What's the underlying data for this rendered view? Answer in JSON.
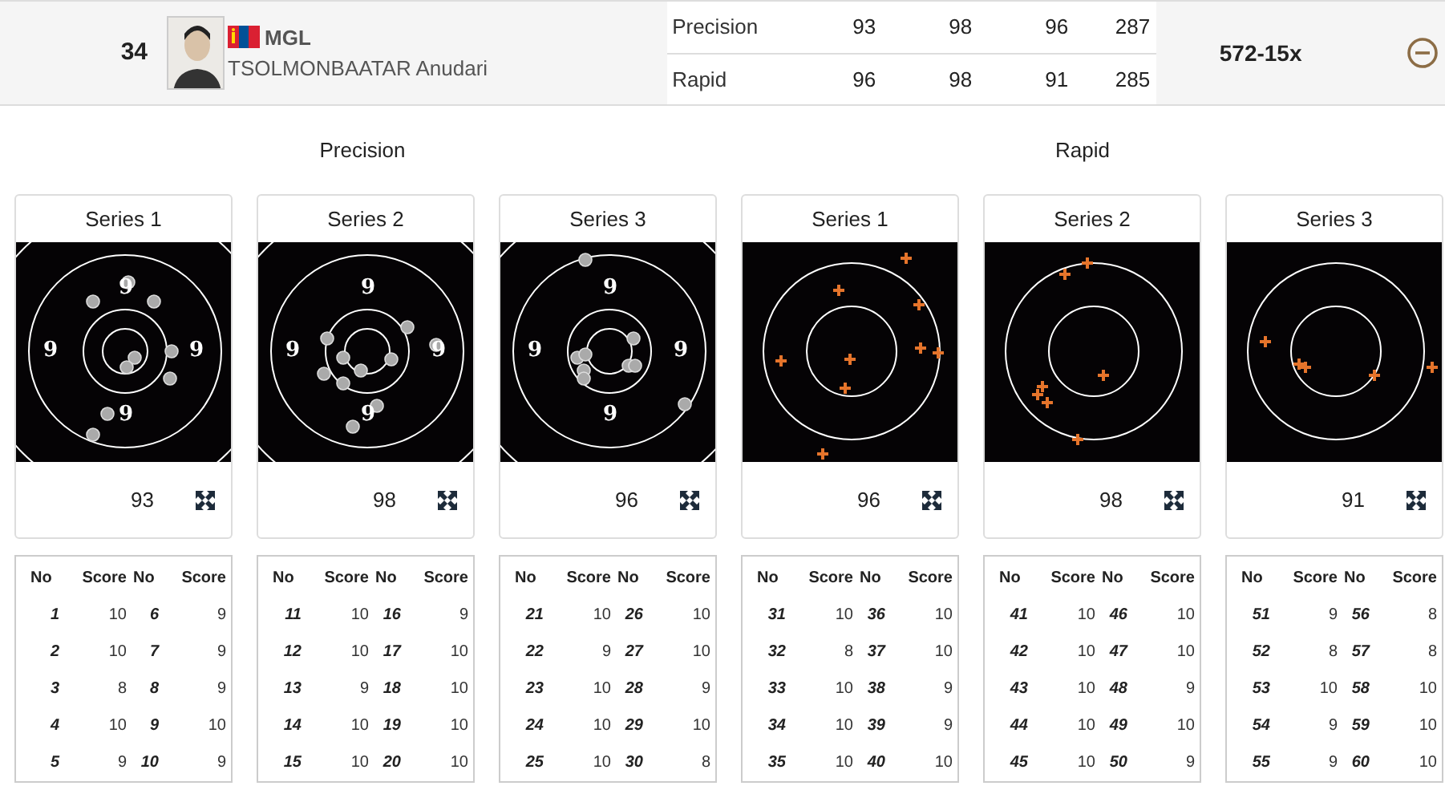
{
  "athlete": {
    "rank": "34",
    "country": "MGL",
    "name": "TSOLMONBAATAR Anudari",
    "total": "572-15x",
    "expanded": true,
    "stages": [
      {
        "label": "Precision",
        "scores": [
          "93",
          "98",
          "96"
        ],
        "total": "287"
      },
      {
        "label": "Rapid",
        "scores": [
          "96",
          "98",
          "91"
        ],
        "total": "285"
      }
    ]
  },
  "sections": [
    {
      "title": "Precision",
      "kind": "precision",
      "series": [
        {
          "title": "Series 1",
          "score": "93",
          "ring_labels": [
            "9",
            "9",
            "9",
            "9"
          ],
          "columns": [
            "No",
            "Score",
            "No",
            "Score"
          ],
          "shots": [
            {
              "no": "1",
              "score": "10"
            },
            {
              "no": "2",
              "score": "10"
            },
            {
              "no": "3",
              "score": "8"
            },
            {
              "no": "4",
              "score": "10"
            },
            {
              "no": "5",
              "score": "9"
            },
            {
              "no": "6",
              "score": "9"
            },
            {
              "no": "7",
              "score": "9"
            },
            {
              "no": "8",
              "score": "9"
            },
            {
              "no": "9",
              "score": "10"
            },
            {
              "no": "10",
              "score": "9"
            }
          ]
        },
        {
          "title": "Series 2",
          "score": "98",
          "ring_labels": [
            "9",
            "9",
            "9",
            "9"
          ],
          "columns": [
            "No",
            "Score",
            "No",
            "Score"
          ],
          "shots": [
            {
              "no": "11",
              "score": "10"
            },
            {
              "no": "12",
              "score": "10"
            },
            {
              "no": "13",
              "score": "9"
            },
            {
              "no": "14",
              "score": "10"
            },
            {
              "no": "15",
              "score": "10"
            },
            {
              "no": "16",
              "score": "9"
            },
            {
              "no": "17",
              "score": "10"
            },
            {
              "no": "18",
              "score": "10"
            },
            {
              "no": "19",
              "score": "10"
            },
            {
              "no": "20",
              "score": "10"
            }
          ]
        },
        {
          "title": "Series 3",
          "score": "96",
          "ring_labels": [
            "9",
            "9",
            "9",
            "9"
          ],
          "columns": [
            "No",
            "Score",
            "No",
            "Score"
          ],
          "shots": [
            {
              "no": "21",
              "score": "10"
            },
            {
              "no": "22",
              "score": "9"
            },
            {
              "no": "23",
              "score": "10"
            },
            {
              "no": "24",
              "score": "10"
            },
            {
              "no": "25",
              "score": "10"
            },
            {
              "no": "26",
              "score": "10"
            },
            {
              "no": "27",
              "score": "10"
            },
            {
              "no": "28",
              "score": "9"
            },
            {
              "no": "29",
              "score": "10"
            },
            {
              "no": "30",
              "score": "8"
            }
          ]
        }
      ]
    },
    {
      "title": "Rapid",
      "kind": "rapid",
      "series": [
        {
          "title": "Series 1",
          "score": "96",
          "columns": [
            "No",
            "Score",
            "No",
            "Score"
          ],
          "shots": [
            {
              "no": "31",
              "score": "10"
            },
            {
              "no": "32",
              "score": "8"
            },
            {
              "no": "33",
              "score": "10"
            },
            {
              "no": "34",
              "score": "10"
            },
            {
              "no": "35",
              "score": "10"
            },
            {
              "no": "36",
              "score": "10"
            },
            {
              "no": "37",
              "score": "10"
            },
            {
              "no": "38",
              "score": "9"
            },
            {
              "no": "39",
              "score": "9"
            },
            {
              "no": "40",
              "score": "10"
            }
          ]
        },
        {
          "title": "Series 2",
          "score": "98",
          "columns": [
            "No",
            "Score",
            "No",
            "Score"
          ],
          "shots": [
            {
              "no": "41",
              "score": "10"
            },
            {
              "no": "42",
              "score": "10"
            },
            {
              "no": "43",
              "score": "10"
            },
            {
              "no": "44",
              "score": "10"
            },
            {
              "no": "45",
              "score": "10"
            },
            {
              "no": "46",
              "score": "10"
            },
            {
              "no": "47",
              "score": "10"
            },
            {
              "no": "48",
              "score": "9"
            },
            {
              "no": "49",
              "score": "10"
            },
            {
              "no": "50",
              "score": "9"
            }
          ]
        },
        {
          "title": "Series 3",
          "score": "91",
          "columns": [
            "No",
            "Score",
            "No",
            "Score"
          ],
          "shots": [
            {
              "no": "51",
              "score": "9"
            },
            {
              "no": "52",
              "score": "8"
            },
            {
              "no": "53",
              "score": "10"
            },
            {
              "no": "54",
              "score": "9"
            },
            {
              "no": "55",
              "score": "9"
            },
            {
              "no": "56",
              "score": "8"
            },
            {
              "no": "57",
              "score": "8"
            },
            {
              "no": "58",
              "score": "10"
            },
            {
              "no": "59",
              "score": "10"
            },
            {
              "no": "60",
              "score": "10"
            }
          ]
        }
      ]
    }
  ]
}
